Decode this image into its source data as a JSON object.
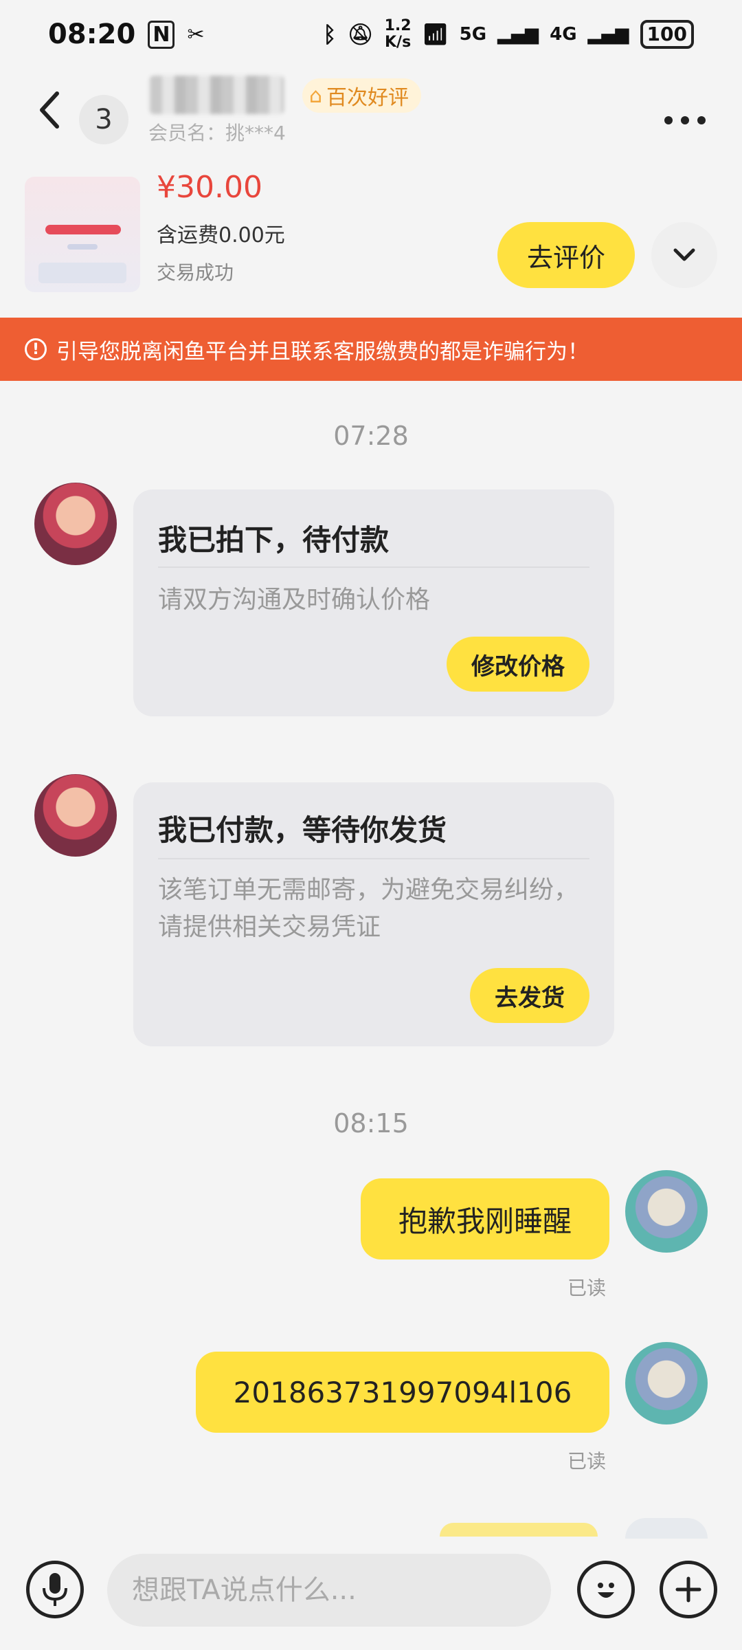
{
  "status_bar": {
    "time": "08:20",
    "speed_top": "1.2",
    "speed_unit": "K/s",
    "network1": "5G",
    "network2": "4G",
    "battery": "100"
  },
  "header": {
    "unread_count": "3",
    "badge_text": "百次好评",
    "member_label": "会员名：挑***4"
  },
  "item": {
    "price": "¥30.00",
    "shipping": "含运费0.00元",
    "status": "交易成功",
    "review_button": "去评价"
  },
  "warning": {
    "text": "引导您脱离闲鱼平台并且联系客服缴费的都是诈骗行为！"
  },
  "messages": {
    "time1": "07:28",
    "card1": {
      "title": "我已拍下，待付款",
      "desc": "请双方沟通及时确认价格",
      "action": "修改价格"
    },
    "card2": {
      "title": "我已付款，等待你发货",
      "desc": "该笔订单无需邮寄，为避免交易纠纷，请提供相关交易凭证",
      "action": "去发货"
    },
    "time2": "08:15",
    "sent1": {
      "text": "抱歉我刚睡醒",
      "read": "已读"
    },
    "sent2": {
      "text": "201863731997094l106",
      "read": "已读"
    }
  },
  "input": {
    "placeholder": "想跟TA说点什么..."
  }
}
